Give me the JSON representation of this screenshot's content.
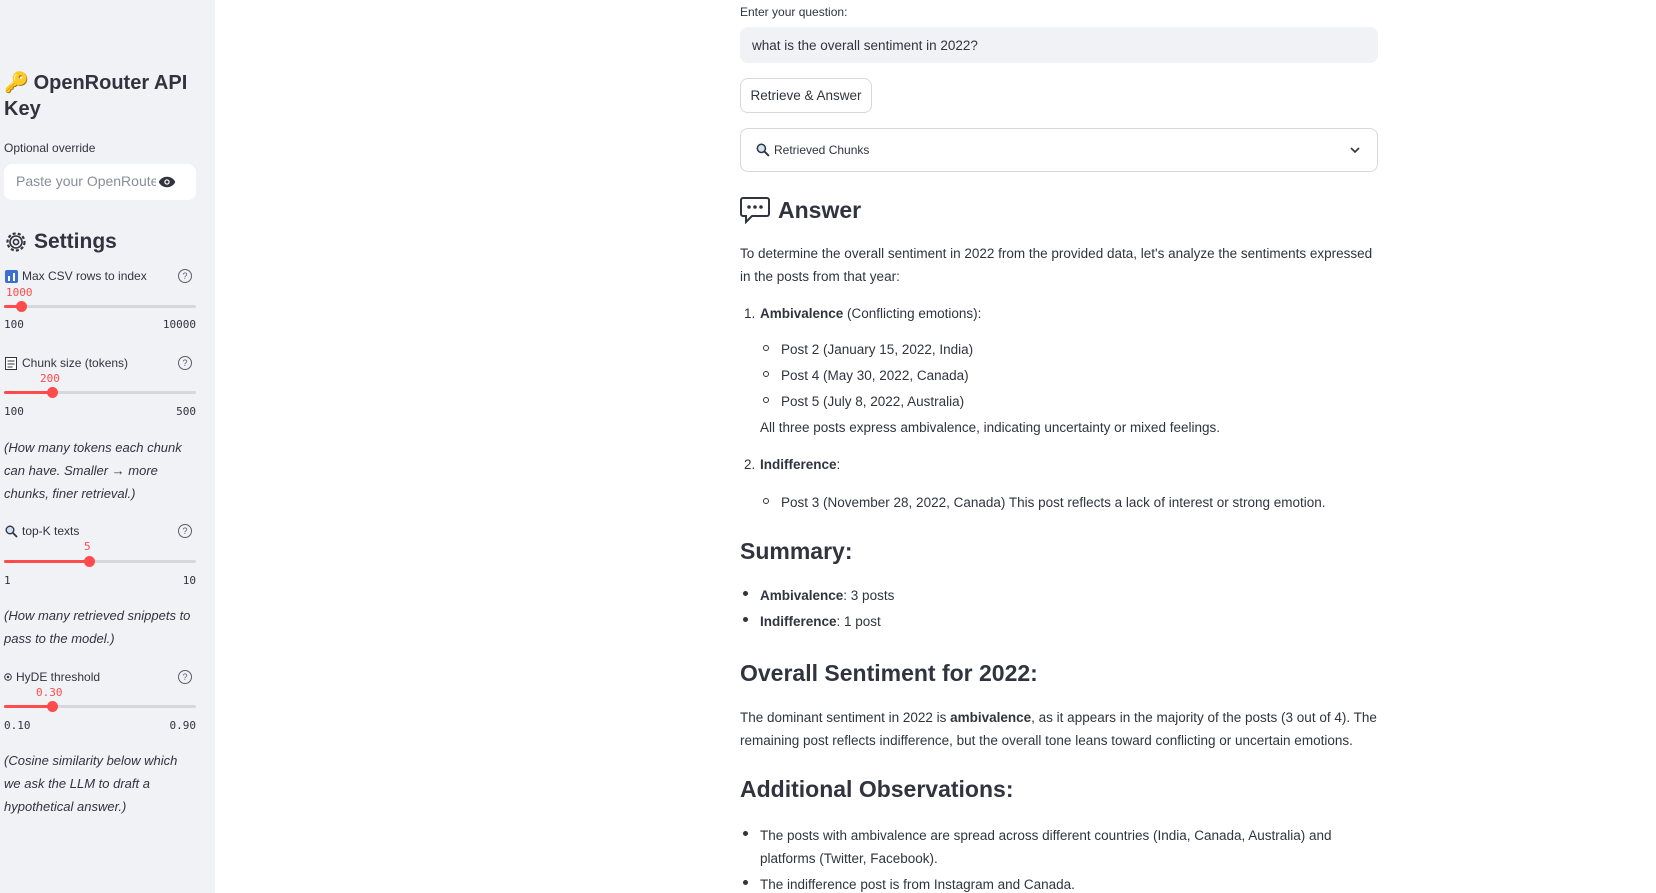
{
  "sidebar": {
    "api_heading": "OpenRouter API Key",
    "api_emoji": "🔑",
    "api_sublabel": "Optional override",
    "api_placeholder": "Paste your OpenRouter API key",
    "settings_heading": "Settings",
    "sliders": [
      {
        "label": "Max CSV rows to index",
        "value": "1000",
        "min": "100",
        "max": "10000",
        "fraction": 0.09
      },
      {
        "label": "Chunk size (tokens)",
        "value": "200",
        "min": "100",
        "max": "500",
        "fraction": 0.25
      },
      {
        "label": "top-K texts",
        "value": "5",
        "min": "1",
        "max": "10",
        "fraction": 0.444
      },
      {
        "label": "HyDE threshold",
        "value": "0.30",
        "min": "0.10",
        "max": "0.90",
        "fraction": 0.25
      }
    ],
    "notes": {
      "chunk": "(How many tokens each chunk can have. Smaller → more chunks, finer retrieval.)",
      "topk": "(How many retrieved snippets to pass to the model.)",
      "hyde": "(Cosine similarity below which we ask the LLM to draft a hypothetical answer.)"
    }
  },
  "main": {
    "question_label": "Enter your question:",
    "question_value": "what is the overall sentiment in 2022?",
    "button_label": "Retrieve & Answer",
    "expander_label": "Retrieved Chunks",
    "answer_heading": "Answer",
    "intro": "To determine the overall sentiment in 2022 from the provided data, let's analyze the sentiments expressed in the posts from that year:",
    "item1_num": "1.",
    "item1_bold": "Ambivalence",
    "item1_rest": " (Conflicting emotions):",
    "item1_posts": [
      "Post 2 (January 15, 2022, India)",
      "Post 4 (May 30, 2022, Canada)",
      "Post 5 (July 8, 2022, Australia)"
    ],
    "item1_note": "All three posts express ambivalence, indicating uncertainty or mixed feelings.",
    "item2_num": "2.",
    "item2_bold": "Indifference",
    "item2_rest": ":",
    "item2_posts": [
      "Post 3 (November 28, 2022, Canada) This post reflects a lack of interest or strong emotion."
    ],
    "summary_heading": "Summary:",
    "summary_items": [
      {
        "bold": "Ambivalence",
        "rest": ": 3 posts"
      },
      {
        "bold": "Indifference",
        "rest": ": 1 post"
      }
    ],
    "overall_heading": "Overall Sentiment for 2022:",
    "overall_pre": "The dominant sentiment in 2022 is ",
    "overall_bold": "ambivalence",
    "overall_post": ", as it appears in the majority of the posts (3 out of 4). The remaining post reflects indifference, but the overall tone leans toward conflicting or uncertain emotions.",
    "additional_heading": "Additional Observations:",
    "additional_items": [
      "The posts with ambivalence are spread across different countries (India, Canada, Australia) and platforms (Twitter, Facebook).",
      "The indifference post is from Instagram and Canada."
    ]
  }
}
